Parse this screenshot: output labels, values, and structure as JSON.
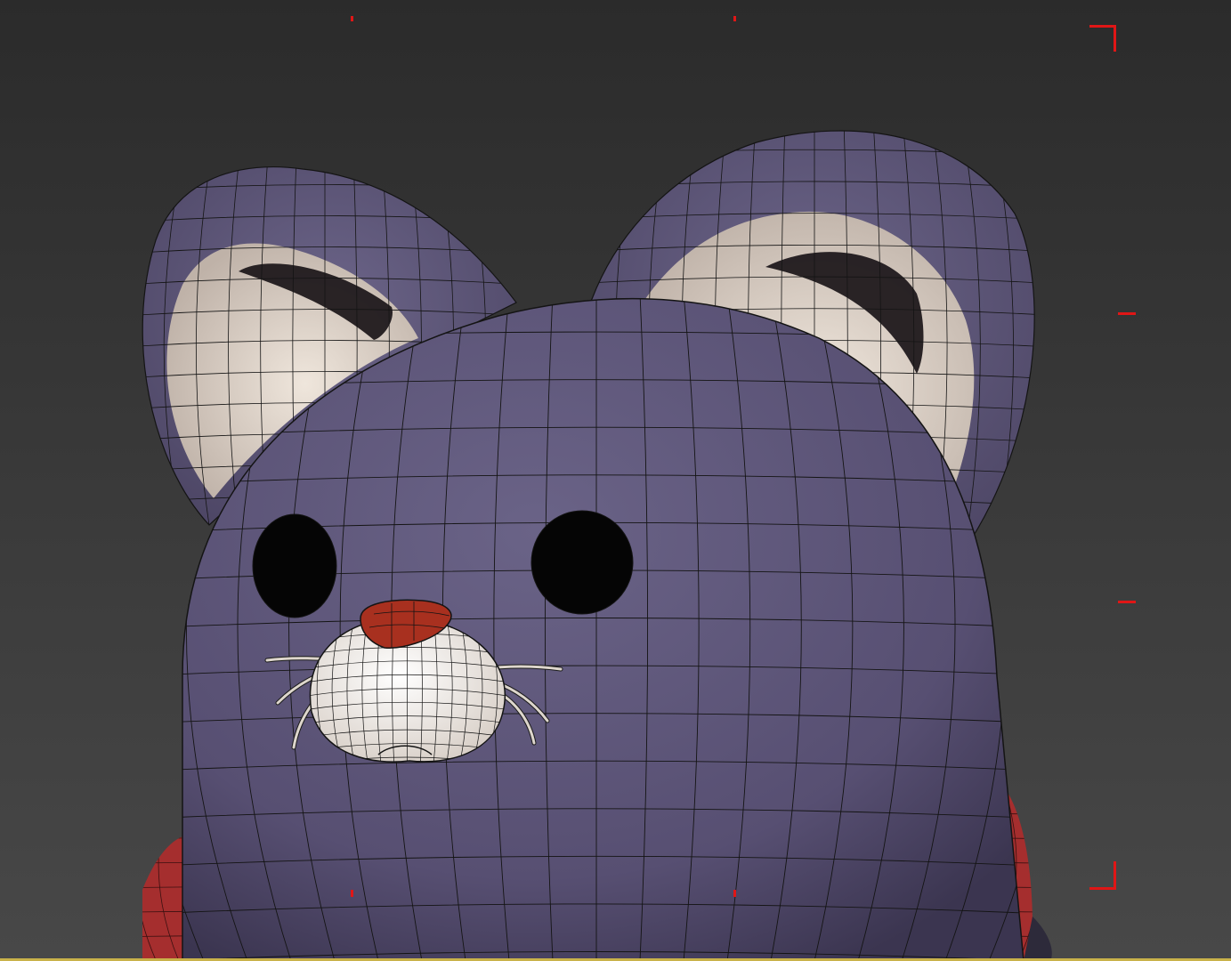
{
  "viewport": {
    "background_top": "#2b2b2b",
    "background_bottom": "#484848",
    "safe_frame_color": "#e01616",
    "bottom_border_color": "#c9b24a"
  },
  "model": {
    "body_color": "#5d5577",
    "body_shadow": "#3f3a55",
    "ear_inner_color": "#ddd2c8",
    "ear_cavity_color": "#1a1518",
    "muzzle_color": "#f3ece6",
    "nose_color": "#a8301f",
    "scarf_color": "#a52e2e",
    "eye_color": "#050505",
    "wire_color": "#141414",
    "whisker_color": "#ddd6cc"
  }
}
